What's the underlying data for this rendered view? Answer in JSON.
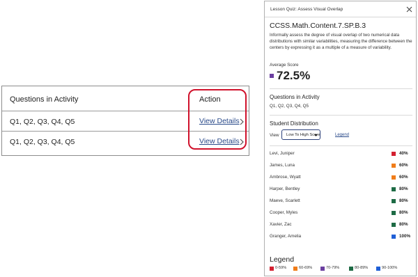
{
  "activity_table": {
    "columns": {
      "questions": "Questions in Activity",
      "action": "Action"
    },
    "rows": [
      {
        "questions": "Q1, Q2, Q3, Q4, Q5",
        "action_link": "View Details"
      },
      {
        "questions": "Q1, Q2, Q3, Q4, Q5",
        "action_link": "View Details"
      }
    ],
    "highlight_color": "#d0112b"
  },
  "panel": {
    "title": "Lesson Quiz: Assess Visual Overlap",
    "close_icon": "close-icon",
    "standard_code": "CCSS.Math.Content.7.SP.B.3",
    "standard_description": "Informally assess the degree of visual overlap of two numerical data distributions with similar variabilities, measuring the difference between the centers by expressing it as a multiple of a measure of variability.",
    "average_score": {
      "label": "Average Score",
      "value": "72.5%",
      "color": "#6b3fa0"
    },
    "questions": {
      "heading": "Questions in Activity",
      "list": "Q1, Q2, Q3, Q4, Q5"
    },
    "distribution": {
      "heading": "Student Distribution",
      "view_label": "View",
      "view_selected": "Low To High Score",
      "legend_link": "Legend",
      "students": [
        {
          "name": "Levi, Juniper",
          "score": "40%",
          "color": "#d32030"
        },
        {
          "name": "James, Luna",
          "score": "60%",
          "color": "#f07d1a"
        },
        {
          "name": "Ambrose, Wyatt",
          "score": "60%",
          "color": "#f07d1a"
        },
        {
          "name": "Harper, Bentley",
          "score": "80%",
          "color": "#1e6b45"
        },
        {
          "name": "Maeve, Scarlett",
          "score": "80%",
          "color": "#1e6b45"
        },
        {
          "name": "Cooper, Myles",
          "score": "80%",
          "color": "#1e6b45"
        },
        {
          "name": "Xavier, Zac",
          "score": "80%",
          "color": "#1e6b45"
        },
        {
          "name": "Granger, Amelia",
          "score": "100%",
          "color": "#1f5fd6"
        }
      ]
    },
    "legend": {
      "heading": "Legend",
      "items": [
        {
          "label": "0-59%",
          "color": "#d32030"
        },
        {
          "label": "60-69%",
          "color": "#f07d1a"
        },
        {
          "label": "70-79%",
          "color": "#6b3fa0"
        },
        {
          "label": "80-89%",
          "color": "#1e6b45"
        },
        {
          "label": "90-100%",
          "color": "#1f5fd6"
        }
      ]
    }
  }
}
